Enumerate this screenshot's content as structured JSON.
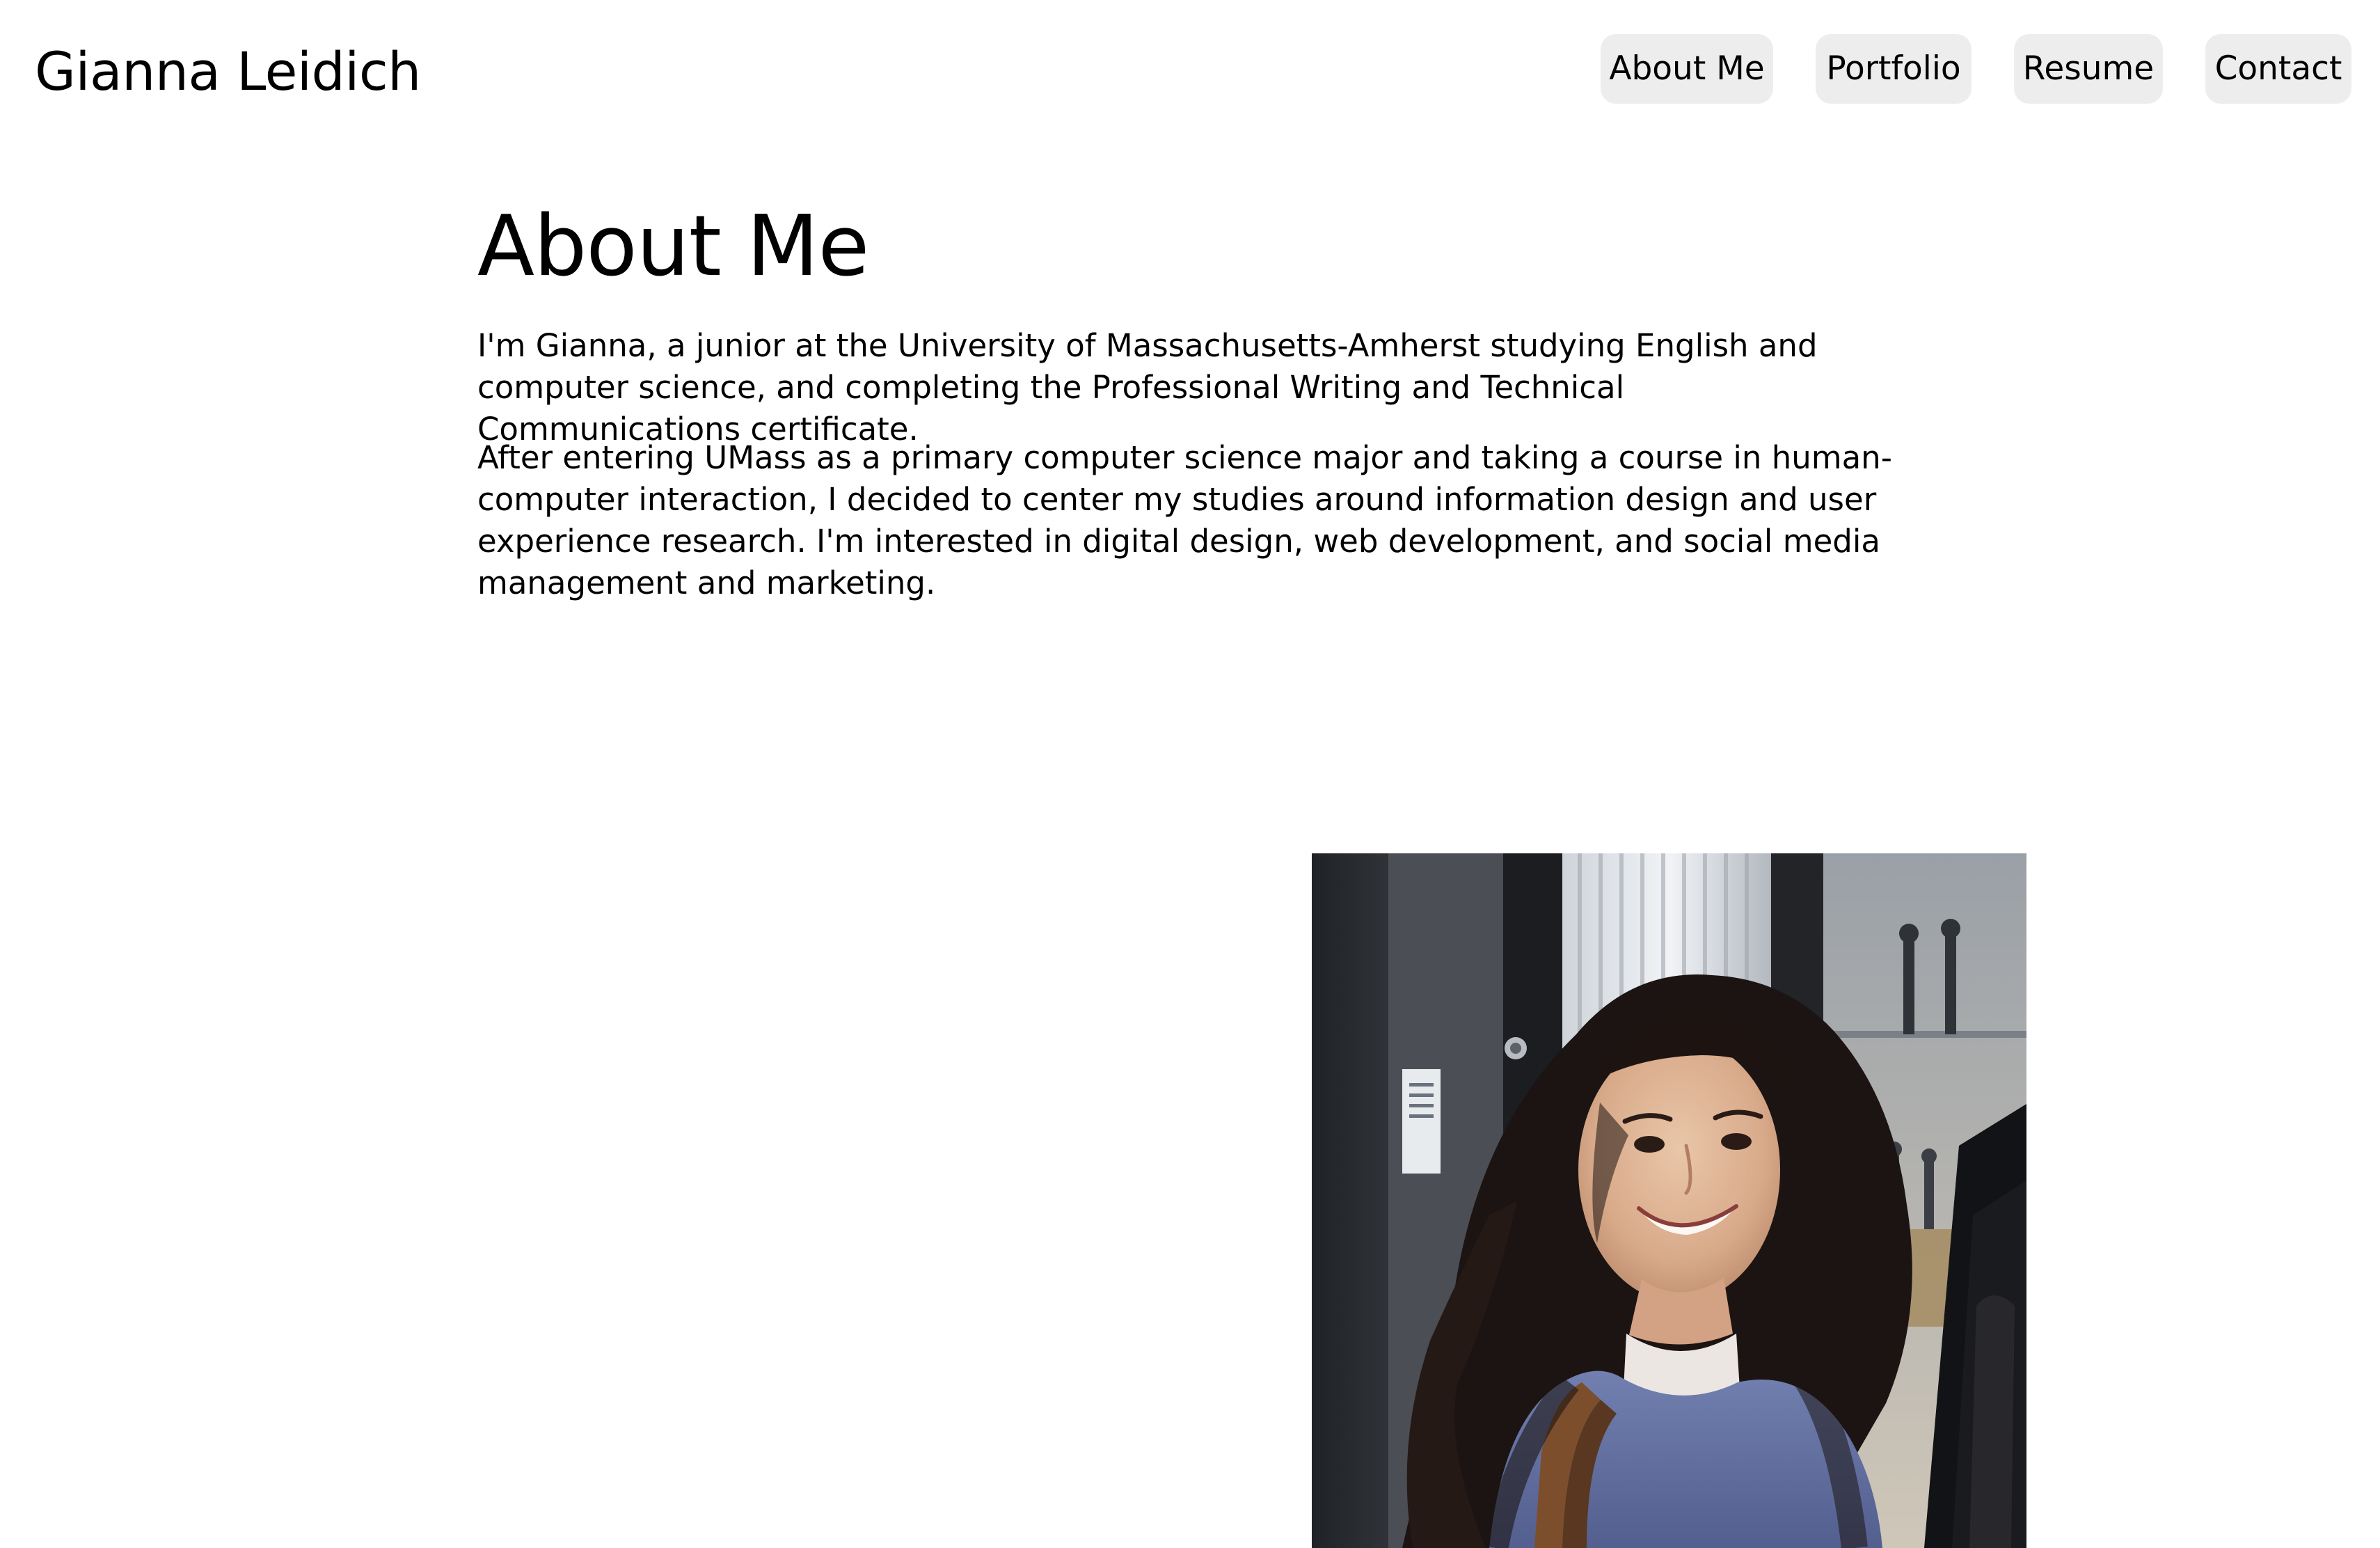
{
  "header": {
    "site_title": "Gianna Leidich",
    "nav": [
      {
        "label": "About Me"
      },
      {
        "label": "Portfolio"
      },
      {
        "label": "Resume"
      },
      {
        "label": "Contact"
      }
    ]
  },
  "main": {
    "heading": "About Me",
    "paragraphs": [
      "I'm Gianna, a junior at the University of Massachusetts-Amherst studying English and computer science, and completing the Professional Writing and Technical Communications certificate.",
      "After entering UMass as a primary computer science major and taking a course in human-computer interaction, I decided to center my studies around information design and user experience research. I'm interested in digital design, web development, and social media management and marketing."
    ],
    "photo": {
      "subject": "portrait-photo"
    }
  },
  "colors": {
    "background": "#ffffff",
    "text": "#000000",
    "nav_button_bg": "#ededed"
  }
}
